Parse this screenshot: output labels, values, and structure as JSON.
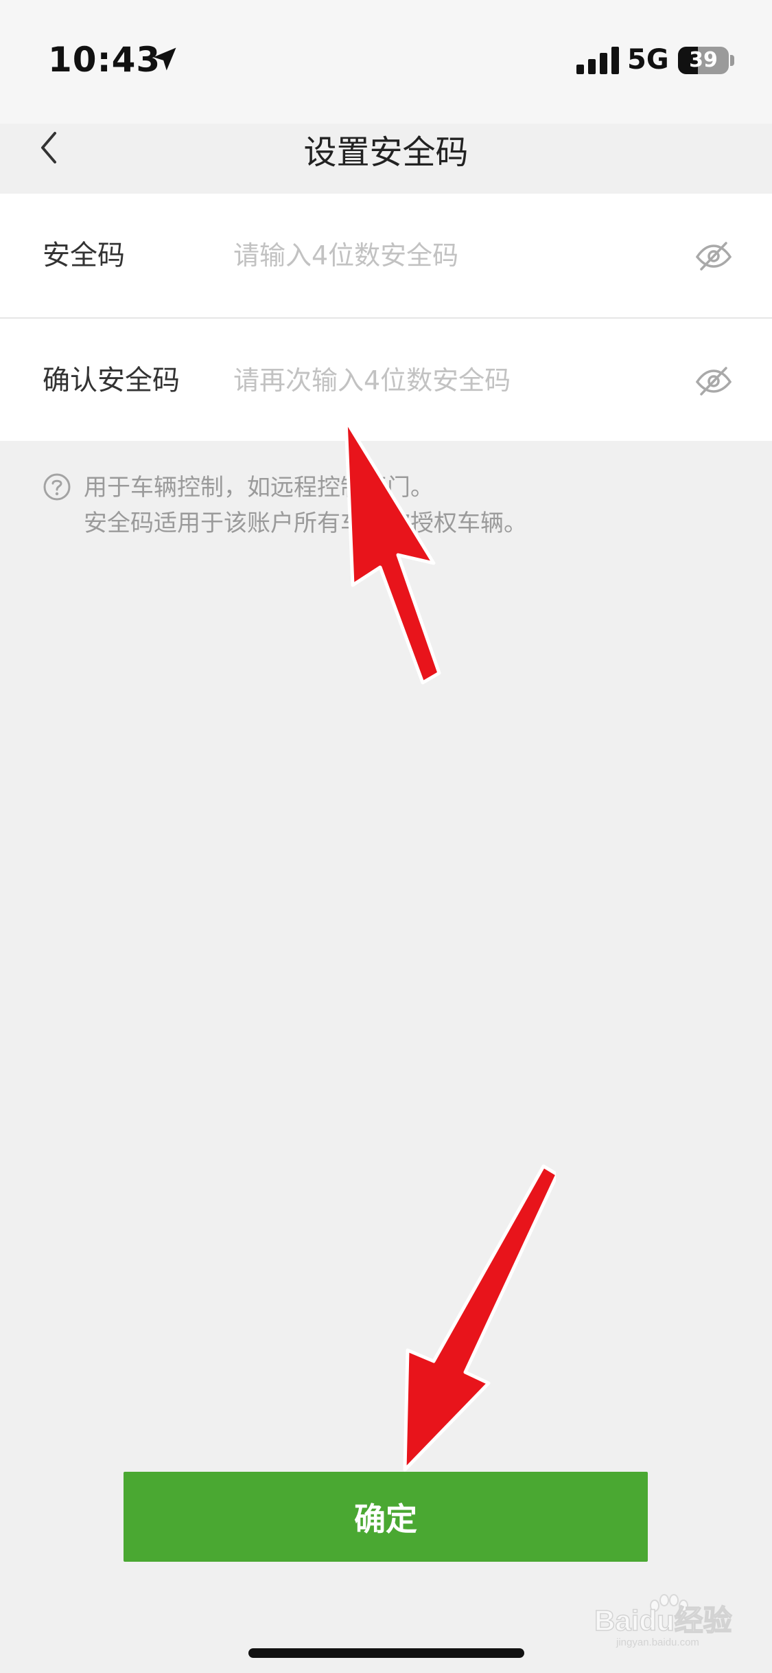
{
  "status_bar": {
    "time": "10:43",
    "network": "5G",
    "battery_level": "39"
  },
  "nav": {
    "title": "设置安全码"
  },
  "form": {
    "rows": [
      {
        "label": "安全码",
        "placeholder": "请输入4位数安全码"
      },
      {
        "label": "确认安全码",
        "placeholder": "请再次输入4位数安全码"
      }
    ]
  },
  "hint": {
    "line1": "用于车辆控制，如远程控制开门。",
    "line2": "安全码适用于该账户所有车及被授权车辆。"
  },
  "confirm": {
    "label": "确定"
  },
  "watermark": {
    "text": "Baidu经验",
    "subtext": "jingyan.baidu.com"
  },
  "colors": {
    "primary_green": "#4aa832",
    "annotation_red": "#e8141b",
    "page_bg": "#f0f0f0"
  }
}
